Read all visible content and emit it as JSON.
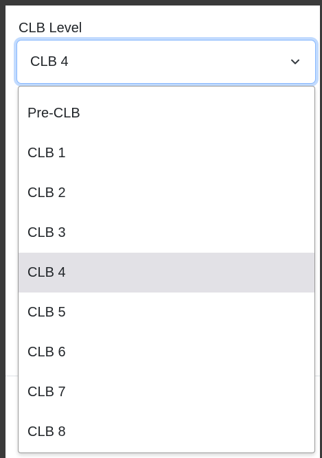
{
  "field": {
    "label": "CLB Level",
    "selected_value": "CLB 4"
  },
  "icons": {
    "chevron": "chevron-down-icon"
  },
  "colors": {
    "focus_border": "#86b7fe",
    "selected_option_bg": "#e2e1e6",
    "text": "#212529"
  },
  "dropdown": {
    "selected_index": 4,
    "options": [
      {
        "label": "Pre-CLB"
      },
      {
        "label": "CLB 1"
      },
      {
        "label": "CLB 2"
      },
      {
        "label": "CLB 3"
      },
      {
        "label": "CLB 4"
      },
      {
        "label": "CLB 5"
      },
      {
        "label": "CLB 6"
      },
      {
        "label": "CLB 7"
      },
      {
        "label": "CLB 8"
      }
    ]
  }
}
